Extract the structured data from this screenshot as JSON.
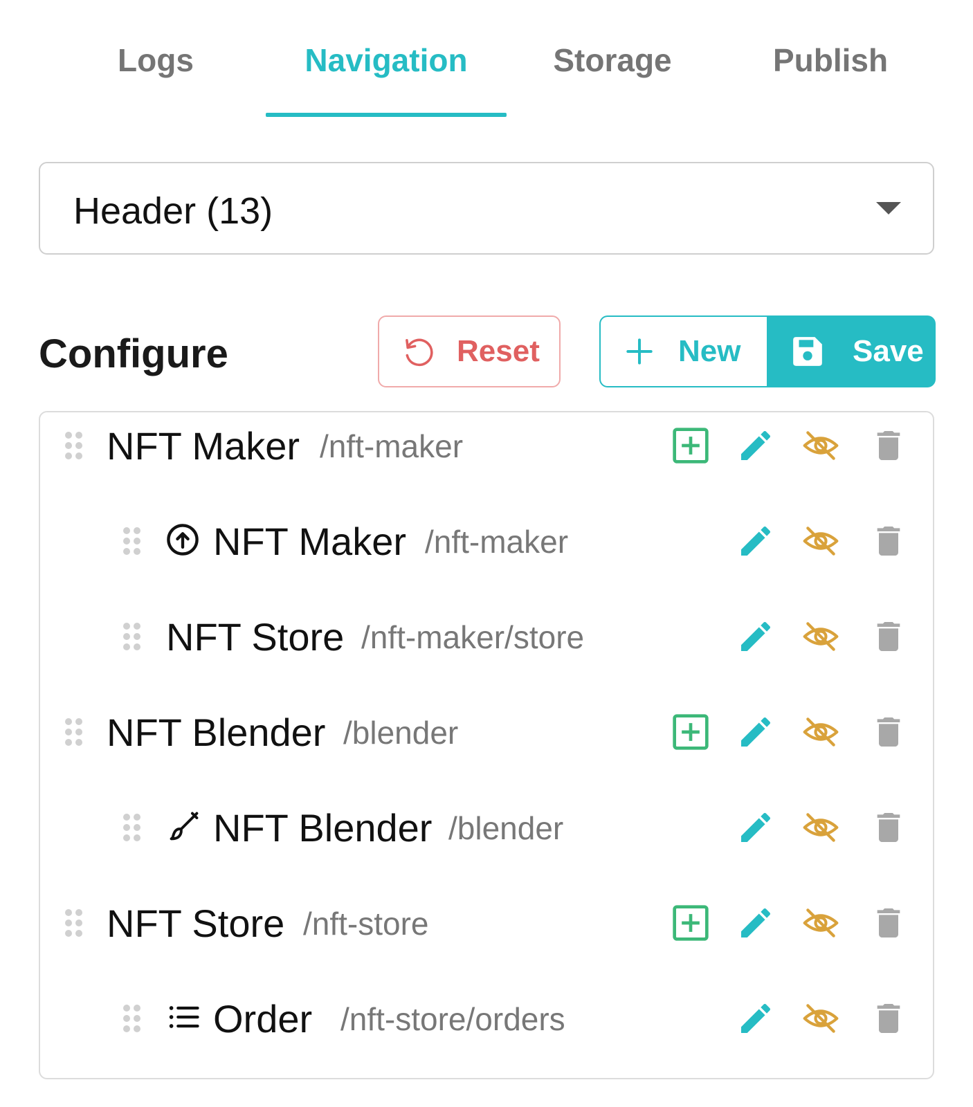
{
  "tabs": [
    {
      "label": "Logs",
      "active": false
    },
    {
      "label": "Navigation",
      "active": true
    },
    {
      "label": "Storage",
      "active": false
    },
    {
      "label": "Publish",
      "active": false
    }
  ],
  "menu_select": {
    "value": "Header (13)"
  },
  "configure": {
    "title": "Configure",
    "reset_label": "Reset",
    "new_label": "New",
    "save_label": "Save"
  },
  "items": [
    {
      "label": "NFT Maker",
      "path": "/nft-maker",
      "level": 0,
      "icon": null,
      "can_add_child": true
    },
    {
      "label": "NFT Maker",
      "path": "/nft-maker",
      "level": 1,
      "icon": "arrow-up-circle-icon",
      "can_add_child": false
    },
    {
      "label": "NFT Store",
      "path": "/nft-maker/store",
      "level": 1,
      "icon": null,
      "can_add_child": false
    },
    {
      "label": "NFT Blender",
      "path": "/blender",
      "level": 0,
      "icon": null,
      "can_add_child": true
    },
    {
      "label": "NFT Blender",
      "path": "/blender",
      "level": 1,
      "icon": "brush-icon",
      "can_add_child": false
    },
    {
      "label": "NFT Store",
      "path": "/nft-store",
      "level": 0,
      "icon": null,
      "can_add_child": true
    },
    {
      "label": "Order",
      "path": "/nft-store/orders",
      "level": 1,
      "icon": "list-icon",
      "can_add_child": false
    }
  ],
  "colors": {
    "accent": "#26bcc4",
    "reset": "#e06060",
    "add": "#3cb878",
    "hidden": "#d9a23b",
    "delete": "#a8a8a8"
  }
}
